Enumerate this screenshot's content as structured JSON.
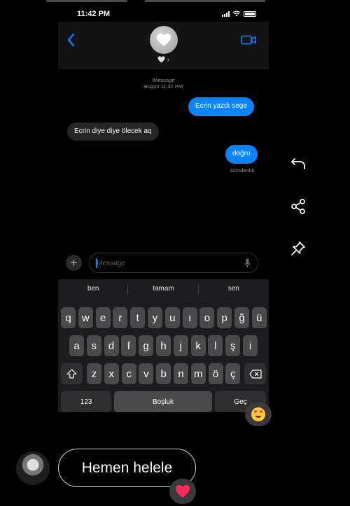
{
  "status_bar": {
    "time": "11:42 PM"
  },
  "conversation": {
    "contact_name": "🤍 ›",
    "avatar_emoji": "🤍"
  },
  "thread": {
    "service": "iMessage",
    "timestamp": "Bugün 11:42 PM",
    "messages": [
      {
        "from": "me",
        "text": "Ecrin yazdı sege"
      },
      {
        "from": "them",
        "text": "Ecrin diye diye ölecek aq"
      },
      {
        "from": "me",
        "text": "doğru"
      }
    ],
    "delivery_status": "Gönderildi"
  },
  "composer": {
    "plus_label": "+",
    "placeholder": "iMessage"
  },
  "keyboard": {
    "suggestions": [
      "ben",
      "tamam",
      "sen"
    ],
    "row1": [
      "q",
      "w",
      "e",
      "r",
      "t",
      "y",
      "u",
      "ı",
      "o",
      "p",
      "ğ",
      "ü"
    ],
    "row2": [
      "a",
      "s",
      "d",
      "f",
      "g",
      "h",
      "j",
      "k",
      "l",
      "ş",
      "i"
    ],
    "row3": [
      "z",
      "x",
      "c",
      "v",
      "b",
      "n",
      "m",
      "ö",
      "ç"
    ],
    "numbers_label": "123",
    "space_label": "Boşluk",
    "return_label": "Geç"
  },
  "story_overlay": {
    "reaction_emoji": "😍",
    "reply_text": "Hemen helele",
    "reply_reaction_emoji": "❤️",
    "side_icons": [
      "reply-icon",
      "share-icon",
      "pin-icon"
    ]
  },
  "colors": {
    "sent_bubble": "#0a84ff",
    "received_bubble": "#262628",
    "keyboard_bg": "#1c1c1e"
  }
}
